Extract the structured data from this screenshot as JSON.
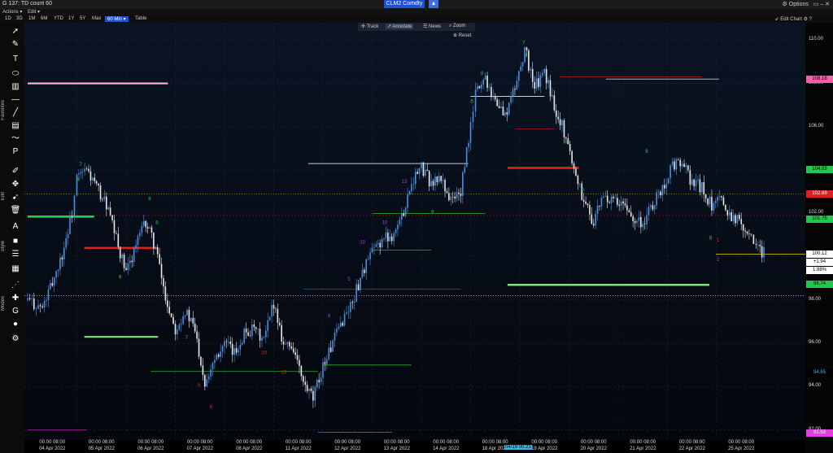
{
  "window": {
    "title": "G 137: TD count 60",
    "ticker": "CLM2 Comdty",
    "ticker_arrow": "▲",
    "options": "⚙ Options",
    "controls": "▭ – ✕"
  },
  "menu": {
    "actions": "Actions ▾",
    "edit": "Edit ▾"
  },
  "toolbar": {
    "periods": [
      "1D",
      "3D",
      "1M",
      "6M",
      "YTD",
      "1Y",
      "5Y",
      "Max"
    ],
    "interval": "60 Min ▾",
    "table": "Table",
    "edit_chart": "⇙ Edit Chart ⚙ ?"
  },
  "overlay": {
    "track": "✣ Track",
    "annotate": "↗ Annotate",
    "news": "☰ News",
    "zoom": "⌕ Zoom",
    "reset": "⊕ Reset"
  },
  "sidebar_labels": {
    "favorites": "Favorites",
    "edit": "Edit",
    "style": "Style",
    "modes": "Modes"
  },
  "sidebar_icons": [
    "pointer-icon",
    "pencil-icon",
    "text-icon",
    "ellipse-icon",
    "fib-icon",
    "hline-icon",
    "trendline-icon",
    "channel-icon",
    "polyline-icon",
    "p-icon",
    "brush-icon",
    "move-icon",
    "cursor-icon",
    "trash-icon",
    "font-icon",
    "fill-icon",
    "line-style-icon",
    "layers-icon",
    "crosshair-icon",
    "snap-icon",
    "magnet-icon",
    "color-icon",
    "gear-icon"
  ],
  "price_axis": {
    "ticks": [
      "110.00",
      "108.00",
      "106.00",
      "104.00",
      "102.00",
      "100.00",
      "98.00",
      "96.00",
      "94.00",
      "92.00"
    ],
    "tags": [
      {
        "text": "108.18",
        "bg": "#ff5ca8",
        "fg": "#000"
      },
      {
        "text": "104.03",
        "bg": "#22c84e",
        "fg": "#000"
      },
      {
        "text": "102.89",
        "bg": "#e02020",
        "fg": "#fff"
      },
      {
        "text": "101.75",
        "bg": "#22c84e",
        "fg": "#000"
      },
      {
        "text": "100.12",
        "bg": "#fff",
        "fg": "#000"
      },
      {
        "text": "+1.94",
        "bg": "#fff",
        "fg": "#000"
      },
      {
        "text": "1.98%",
        "bg": "#fff",
        "fg": "#000"
      },
      {
        "text": "98.74",
        "bg": "#22c84e",
        "fg": "#000"
      },
      {
        "text": "94.65",
        "bg": "#000",
        "fg": "#3bb6e6"
      },
      {
        "text": "91.53",
        "bg": "#e040e0",
        "fg": "#fff"
      }
    ]
  },
  "cursor_time": "04/19 00:23",
  "chart_data": {
    "type": "candlestick",
    "ylim": [
      91.5,
      110.8
    ],
    "x": [
      "04 Apr 2022",
      "05 Apr 2022",
      "06 Apr 2022",
      "07 Apr 2022",
      "08 Apr 2022",
      "11 Apr 2022",
      "12 Apr 2022",
      "13 Apr 2022",
      "14 Apr 2022",
      "18 Apr 2022",
      "19 Apr 2022",
      "20 Apr 2022",
      "21 Apr 2022",
      "22 Apr 2022",
      "25 Apr 2022"
    ],
    "x_time_labels": [
      "00:00 08:00",
      "00:00 08:00",
      "00:00 08:00",
      "00:00 08:00",
      "00:00 08:00",
      "00:00 08:00",
      "00:00 08:00",
      "00:00 08:00",
      "00:00 08:00",
      "00:00 08:00",
      "00:00 08:00",
      "00:00 08:00",
      "00:00 08:00",
      "00:00 08:00",
      "00:00 08:00"
    ],
    "price_path": [
      [
        0,
        98.0
      ],
      [
        0.3,
        97.6
      ],
      [
        0.5,
        98.8
      ],
      [
        0.7,
        100.1
      ],
      [
        0.9,
        102.0
      ],
      [
        1.0,
        103.6
      ],
      [
        1.2,
        104.0
      ],
      [
        1.4,
        103.2
      ],
      [
        1.6,
        102.4
      ],
      [
        1.8,
        100.8
      ],
      [
        2.0,
        99.2
      ],
      [
        2.2,
        100.6
      ],
      [
        2.4,
        101.6
      ],
      [
        2.6,
        100.4
      ],
      [
        2.8,
        98.1
      ],
      [
        3.0,
        96.7
      ],
      [
        3.2,
        97.5
      ],
      [
        3.4,
        96.6
      ],
      [
        3.6,
        94.2
      ],
      [
        3.8,
        95.4
      ],
      [
        4.0,
        96.0
      ],
      [
        4.2,
        95.5
      ],
      [
        4.4,
        96.5
      ],
      [
        4.6,
        96.6
      ],
      [
        4.8,
        96.1
      ],
      [
        5.0,
        97.9
      ],
      [
        5.2,
        96.0
      ],
      [
        5.4,
        95.8
      ],
      [
        5.6,
        94.1
      ],
      [
        5.8,
        93.4
      ],
      [
        6.0,
        95.0
      ],
      [
        6.2,
        96.0
      ],
      [
        6.4,
        97.1
      ],
      [
        6.6,
        97.9
      ],
      [
        6.8,
        99.3
      ],
      [
        7.0,
        100.2
      ],
      [
        7.2,
        100.8
      ],
      [
        7.4,
        101.0
      ],
      [
        7.6,
        101.8
      ],
      [
        7.8,
        103.5
      ],
      [
        8.0,
        104.1
      ],
      [
        8.2,
        103.4
      ],
      [
        8.4,
        103.6
      ],
      [
        8.6,
        102.6
      ],
      [
        8.8,
        103.0
      ],
      [
        9.0,
        106.0
      ],
      [
        9.1,
        107.6
      ],
      [
        9.3,
        108.3
      ],
      [
        9.5,
        107.2
      ],
      [
        9.7,
        106.5
      ],
      [
        9.9,
        107.8
      ],
      [
        10.1,
        109.6
      ],
      [
        10.3,
        107.8
      ],
      [
        10.5,
        108.5
      ],
      [
        10.7,
        107.0
      ],
      [
        10.9,
        105.8
      ],
      [
        11.1,
        104.1
      ],
      [
        11.3,
        102.6
      ],
      [
        11.5,
        101.6
      ],
      [
        11.7,
        102.8
      ],
      [
        11.9,
        102.5
      ],
      [
        12.1,
        102.3
      ],
      [
        12.3,
        101.9
      ],
      [
        12.5,
        101.5
      ],
      [
        12.7,
        102.4
      ],
      [
        12.9,
        103.2
      ],
      [
        13.1,
        104.2
      ],
      [
        13.3,
        104.3
      ],
      [
        13.5,
        103.4
      ],
      [
        13.7,
        103.2
      ],
      [
        13.9,
        102.3
      ],
      [
        14.1,
        102.6
      ],
      [
        14.3,
        101.9
      ],
      [
        14.5,
        101.6
      ],
      [
        14.7,
        101.0
      ],
      [
        14.8,
        100.4
      ],
      [
        15.0,
        100.1
      ]
    ]
  }
}
